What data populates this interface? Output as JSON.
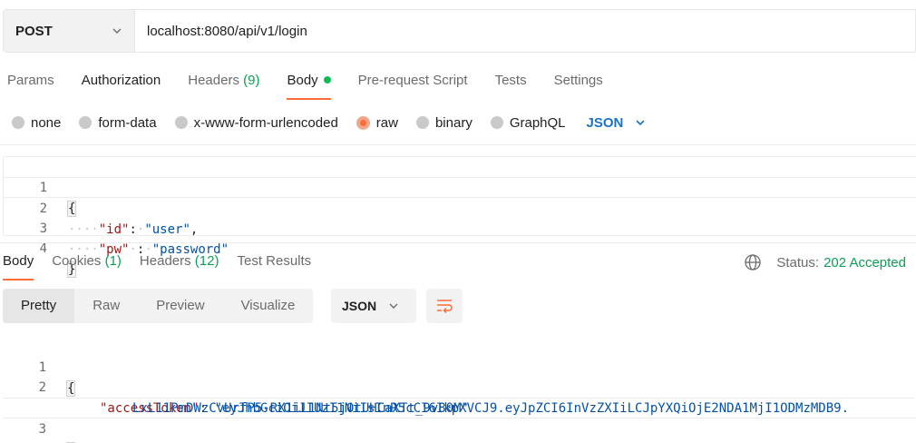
{
  "request": {
    "method": "POST",
    "url": "localhost:8080/api/v1/login"
  },
  "request_tabs": {
    "params": "Params",
    "authorization": "Authorization",
    "headers_label": "Headers",
    "headers_count": "(9)",
    "body": "Body",
    "prerequest": "Pre-request Script",
    "tests": "Tests",
    "settings": "Settings"
  },
  "body_types": {
    "none": "none",
    "form_data": "form-data",
    "urlencoded": "x-www-form-urlencoded",
    "raw": "raw",
    "binary": "binary",
    "graphql": "GraphQL",
    "format": "JSON"
  },
  "request_body": {
    "lines": [
      "1",
      "2",
      "3",
      "4"
    ],
    "open_brace": "{",
    "close_brace": "}",
    "key1": "\"id\"",
    "val1": "\"user\"",
    "key2": "\"pw\"",
    "val2": "\"password\""
  },
  "response_tabs": {
    "body": "Body",
    "cookies_label": "Cookies",
    "cookies_count": "(1)",
    "headers_label": "Headers",
    "headers_count": "(12)",
    "test_results": "Test Results"
  },
  "status": {
    "label": "Status:",
    "value": "202 Accepted"
  },
  "views": {
    "pretty": "Pretty",
    "raw": "Raw",
    "preview": "Preview",
    "visualize": "Visualize",
    "format": "JSON"
  },
  "response_body": {
    "lines": [
      "1",
      "2",
      "3"
    ],
    "open_brace": "{",
    "close_brace": "}",
    "key": "\"accessToken\"",
    "val_part1": "\"eyJhbGciOiJIUzI1NiIsInR5cCI6IkpXVCJ9.eyJpZCI6InVzZXIiLCJpYXQiOjE2NDA1MjI1ODMzMDB9.",
    "val_part2": "LxL11PmDWzCvUrfP5-RX1iL1Nt5j0tUHCaXTt_9v80M\""
  },
  "colors": {
    "accent": "#ff6c37",
    "status_green": "#0f9d58",
    "link_blue": "#1a73c9"
  }
}
